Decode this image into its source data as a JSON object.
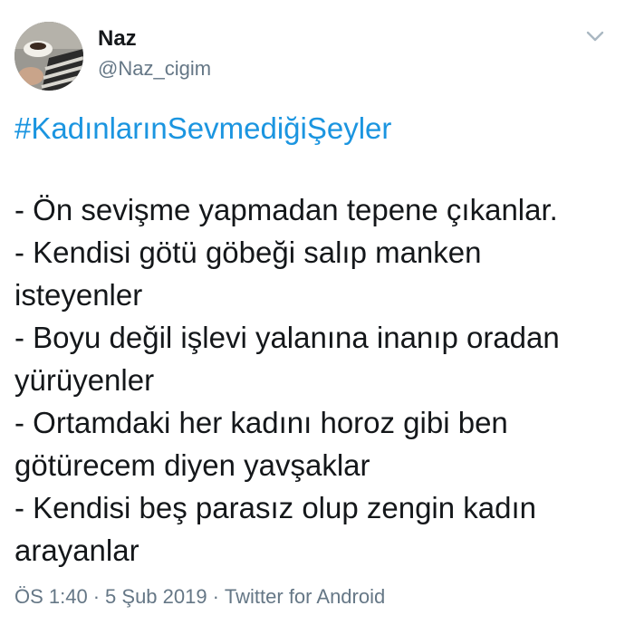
{
  "author": {
    "display_name": "Naz",
    "handle": "@Naz_cigim"
  },
  "tweet": {
    "hashtag": "#KadınlarınSevmediğiŞeyler",
    "lines": [
      "- Ön sevişme yapmadan tepene çıkanlar.",
      "- Kendisi götü göbeği salıp manken",
      "isteyenler",
      "- Boyu değil işlevi yalanına inanıp oradan",
      "yürüyenler",
      "- Ortamdaki her kadını horoz gibi ben",
      "götürecem diyen yavşaklar",
      "- Kendisi beş parasız olup zengin kadın",
      "arayanlar"
    ],
    "time": "ÖS 1:40",
    "separator": "·",
    "date": "5 Şub 2019",
    "source": "Twitter for Android"
  },
  "icons": {
    "menu": "chevron-down-icon",
    "avatar": "avatar"
  },
  "colors": {
    "hashtag": "#1b95e0",
    "text": "#14171a",
    "secondary": "#657786",
    "background": "#ffffff"
  }
}
